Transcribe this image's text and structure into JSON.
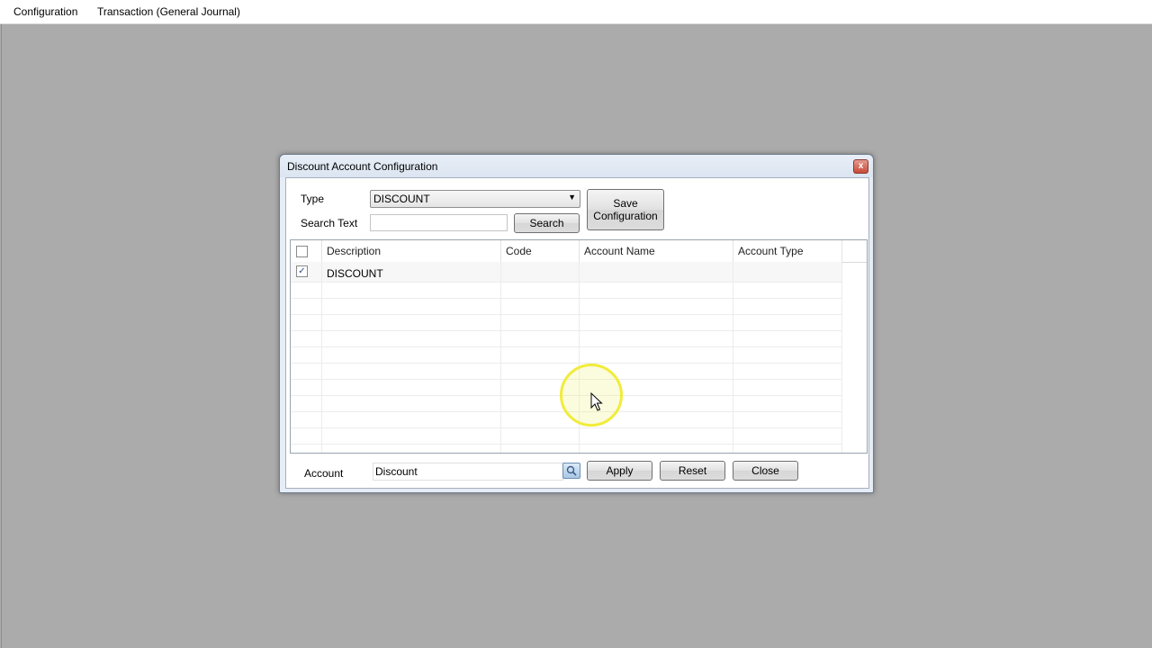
{
  "menubar": {
    "items": [
      {
        "label": "Configuration"
      },
      {
        "label": "Transaction (General Journal)"
      }
    ]
  },
  "dialog": {
    "title": "Discount Account Configuration",
    "close_glyph": "x",
    "type_label": "Type",
    "type_value": "DISCOUNT",
    "search_label": "Search Text",
    "search_value": "",
    "search_button": "Search",
    "save_button_line1": "Save",
    "save_button_line2": "Configuration",
    "grid": {
      "columns": [
        "Description",
        "Code",
        "Account Name",
        "Account Type"
      ],
      "rows": [
        {
          "checked": true,
          "description": "DISCOUNT",
          "code": "",
          "account_name": "",
          "account_type": ""
        }
      ],
      "header_checked": false
    },
    "account_label": "Account",
    "account_value": "Discount",
    "apply_button": "Apply",
    "reset_button": "Reset",
    "close_button": "Close"
  },
  "icons": {
    "lookup": "magnifier-icon",
    "checkmark": "✓",
    "dropdown": "▼"
  },
  "colors": {
    "workspace": "#ababab",
    "dialog_frame": "#e6edf6",
    "cursor_highlight": "#f0ec3a"
  }
}
